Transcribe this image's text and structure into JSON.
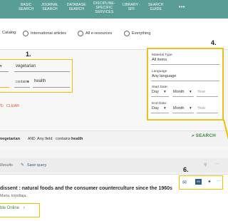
{
  "nav": {
    "items": [
      {
        "line1": "BASIC",
        "line2": "SEARCH"
      },
      {
        "line1": "JOURNAL",
        "line2": "SEARCH"
      },
      {
        "line1": "DATABASE",
        "line2": "SEARCH"
      },
      {
        "line1": "DISCIPLINE-",
        "line2": "SPECIFIC",
        "line3": "SERVICES"
      },
      {
        "line1": "LIBRARY -",
        "line2": "SFF"
      },
      {
        "line1": "SEARCH",
        "line2": "GUIDE"
      }
    ],
    "more_label": "•••"
  },
  "scopes": {
    "items": [
      {
        "label": "Catalog",
        "selected": true
      },
      {
        "label": "International articles",
        "selected": false
      },
      {
        "label": "All e-resources",
        "selected": false
      },
      {
        "label": "Everything",
        "selected": false
      }
    ]
  },
  "search": {
    "rows": [
      {
        "operator": "contains",
        "value": "vegetarian"
      },
      {
        "operator": "contains",
        "value": "health"
      }
    ],
    "clear_label": "CLEAR",
    "search_label": "SEARCH"
  },
  "filters": {
    "material_type_label": "Material Type",
    "material_type_value": "All items",
    "language_label": "Language",
    "language_value": "Any language",
    "start_date_label": "Start Date:",
    "end_date_label": "End Date:",
    "day_placeholder": "Day",
    "month_placeholder": "Month",
    "year_placeholder": "Year"
  },
  "summary": {
    "first_value": "vegetarian",
    "connector": "AND",
    "field": "Any field",
    "relation": "contains",
    "second_value": "health"
  },
  "results": {
    "results_label": "Results",
    "save_query_label": "Save query"
  },
  "result": {
    "title": "dissent : natural foods and the consumer counterculture since the 1960s",
    "author": "Maria, kirjoittaja.",
    "availability": "ble Online"
  },
  "annotations": {
    "one": "1.",
    "four": "4.",
    "six": "6."
  },
  "colors": {
    "nav_bg": "#5a9c96",
    "annotation": "#f1bf00",
    "action_green": "#3c8a3e",
    "link_blue": "#2f5a86"
  }
}
